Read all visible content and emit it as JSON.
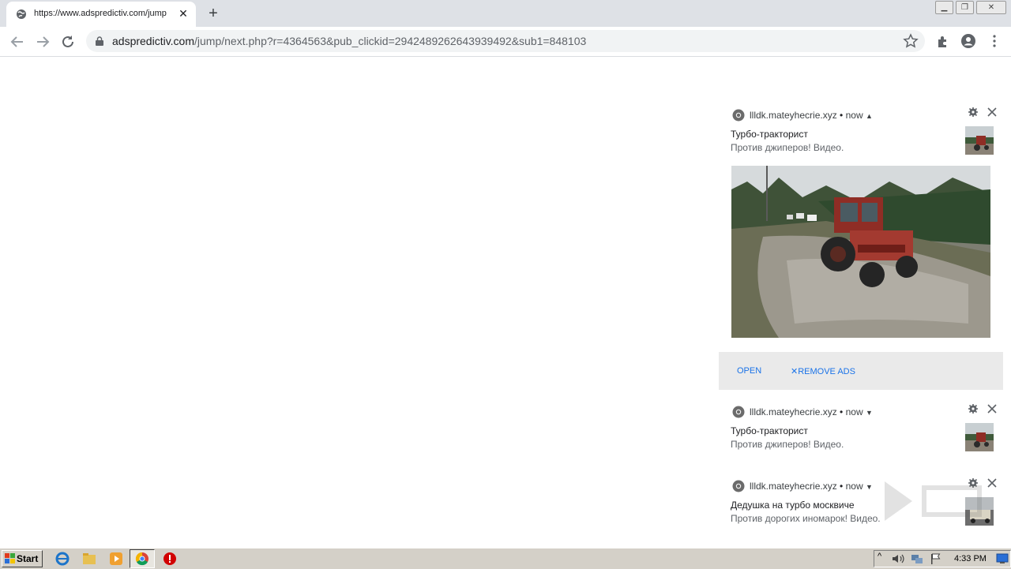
{
  "browser": {
    "tab": {
      "title": "https://www.adspredictiv.com/jump"
    },
    "url": {
      "host": "adspredictiv.com",
      "path": "/jump/next.php?r=4364563&pub_clickid=2942489262643939492&sub1=848103"
    }
  },
  "notifications": [
    {
      "origin": "llldk.mateyhecrie.xyz",
      "time": "now",
      "title": "Турбо-тракторист",
      "body": "Против джиперов! Видео.",
      "expanded": true,
      "actions": {
        "open": "OPEN",
        "remove": "REMOVE ADS"
      }
    },
    {
      "origin": "llldk.mateyhecrie.xyz",
      "time": "now",
      "title": "Турбо-тракторист",
      "body": "Против джиперов! Видео.",
      "expanded": false
    },
    {
      "origin": "llldk.mateyhecrie.xyz",
      "time": "now",
      "title": "Дедушка на турбо москвиче",
      "body": "Против дорогих иномарок! Видео.",
      "expanded": false
    }
  ],
  "taskbar": {
    "start_label": "Start",
    "clock": "4:33 PM"
  },
  "colors": {
    "tabstrip": "#dee1e6",
    "accent_link": "#1a73e8",
    "taskbar": "#d4d0c8"
  },
  "icons": [
    "globe-icon",
    "close-icon",
    "plus-icon",
    "back-icon",
    "forward-icon",
    "reload-icon",
    "lock-icon",
    "star-icon",
    "extensions-icon",
    "profile-icon",
    "menu-icon",
    "gear-icon",
    "chevron-up-icon",
    "chevron-down-icon",
    "chrome-icon",
    "ie-icon",
    "explorer-icon",
    "media-player-icon",
    "stop-icon"
  ]
}
